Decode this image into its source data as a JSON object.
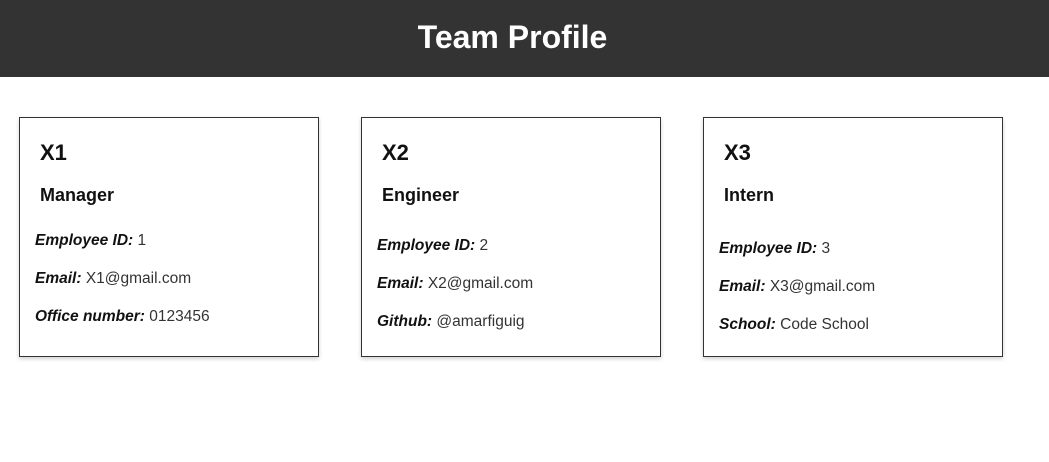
{
  "header": {
    "title": "Team Profile"
  },
  "cards": [
    {
      "name": "X1",
      "role": "Manager",
      "fields": [
        {
          "label": "Employee ID:",
          "value": "1"
        },
        {
          "label": "Email:",
          "value": "X1@gmail.com"
        },
        {
          "label": "Office number:",
          "value": "0123456"
        }
      ]
    },
    {
      "name": "X2",
      "role": "Engineer",
      "fields": [
        {
          "label": "Employee ID:",
          "value": "2"
        },
        {
          "label": "Email:",
          "value": "X2@gmail.com"
        },
        {
          "label": "Github:",
          "value": "@amarfiguig"
        }
      ]
    },
    {
      "name": "X3",
      "role": "Intern",
      "fields": [
        {
          "label": "Employee ID:",
          "value": "3"
        },
        {
          "label": "Email:",
          "value": "X3@gmail.com"
        },
        {
          "label": "School:",
          "value": "Code School"
        }
      ]
    }
  ],
  "colors": {
    "header_bg": "#333333",
    "header_text": "#ffffff",
    "card_border": "#333333"
  }
}
